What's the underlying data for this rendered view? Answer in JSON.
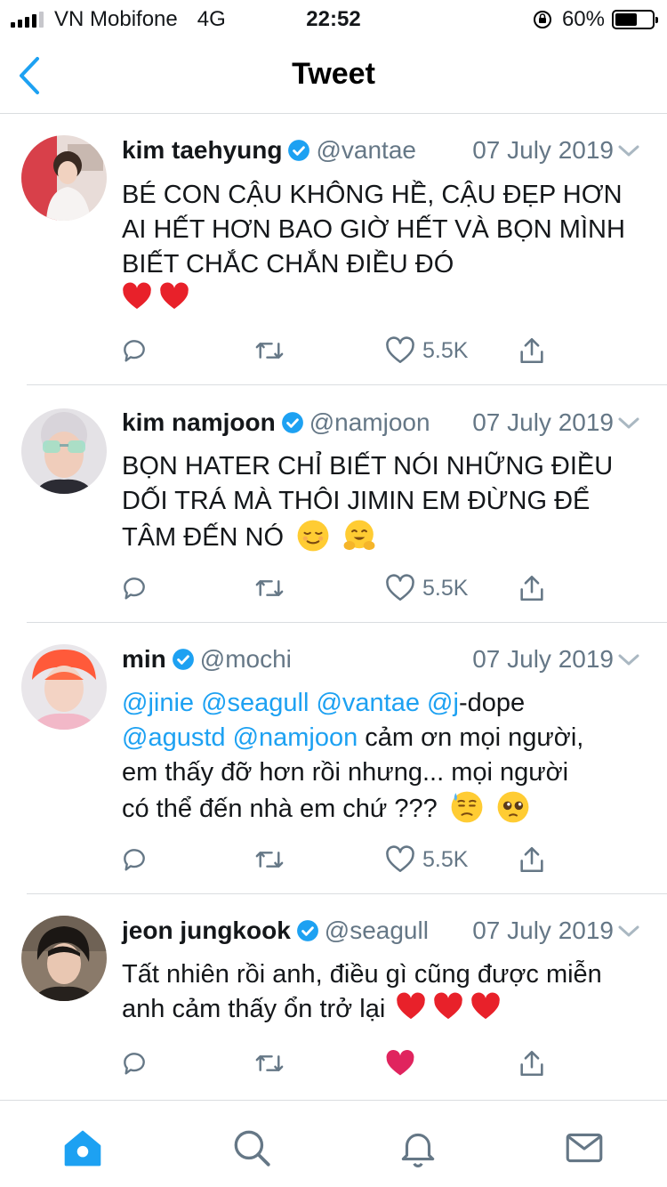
{
  "status_bar": {
    "carrier": "VN Mobifone",
    "network": "4G",
    "time": "22:52",
    "battery": "60%",
    "battery_level": 0.6
  },
  "nav": {
    "title": "Tweet",
    "back_icon": "chevron-left-icon"
  },
  "colors": {
    "accent": "#1da1f2",
    "muted": "#657786",
    "heart_liked": "#e0245e"
  },
  "tweets": [
    {
      "name": "kim taehyung",
      "handle": "@vantae",
      "date": "07 July 2019",
      "text": "BÉ CON CẬU KHÔNG HỀ, CẬU ĐẸP HƠN AI HẾT HƠN BAO GIỜ HẾT VÀ BỌN MÌNH BIẾT CHẮC CHẮN ĐIỀU ĐÓ",
      "likes": "5.5K"
    },
    {
      "name": "kim namjoon",
      "handle": "@namjoon",
      "date": "07 July 2019",
      "text": "BỌN HATER CHỈ BIẾT NÓI NHỮNG ĐIỀU DỐI TRÁ MÀ THÔI JIMIN EM ĐỪNG ĐỂ TÂM ĐẾN NÓ",
      "likes": "5.5K"
    },
    {
      "name": "min",
      "handle": "@mochi",
      "date": "07 July 2019",
      "mentions_line": "@jinie @seagull @vantae @j",
      "after_mentions": "-dope",
      "mentions_line2": "@agustd @namjoon",
      "text_rest_1": " cảm ơn mọi người,",
      "text_rest_2": "em thấy đỡ hơn rồi nhưng... mọi người",
      "text_rest_3": "có thể đến nhà em chứ ???",
      "likes": "5.5K"
    },
    {
      "name": "jeon jungkook",
      "handle": "@seagull",
      "date": "07 July 2019",
      "text": "Tất nhiên rồi anh, điều gì cũng được miễn anh cảm thấy ổn trở lại",
      "likes": ""
    }
  ],
  "tabbar": [
    "home-icon",
    "search-icon",
    "notifications-icon",
    "messages-icon"
  ]
}
